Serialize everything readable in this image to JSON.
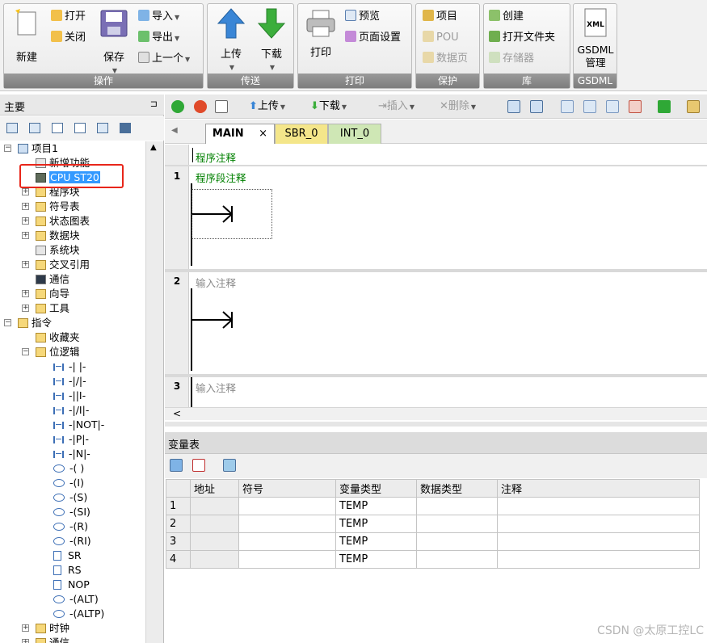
{
  "ribbon": {
    "groups": [
      {
        "title": "操作"
      },
      {
        "title": "传送"
      },
      {
        "title": "打印"
      },
      {
        "title": "保护"
      },
      {
        "title": "库"
      },
      {
        "title": "GSDML"
      }
    ],
    "new_label": "新建",
    "open_label": "打开",
    "close_label": "关闭",
    "save_label": "保存",
    "import_label": "导入",
    "export_label": "导出",
    "previous_label": "上一个",
    "upload_label": "上传",
    "download_label": "下载",
    "print_label": "打印",
    "preview_label": "预览",
    "page_setup_label": "页面设置",
    "project_label": "项目",
    "pou_label": "POU",
    "data_page_label": "数据页",
    "create_label": "创建",
    "open_folder_label": "打开文件夹",
    "memory_label": "存储器",
    "gsdml_icon_text": "XML",
    "gsdml_label_1": "GSDML",
    "gsdml_label_2": "管理"
  },
  "left_panel": {
    "title": "主要",
    "pin": "⊐",
    "tree": [
      {
        "label": "项目1",
        "level": 0,
        "expand": "−",
        "icon": "project"
      },
      {
        "label": "新增功能",
        "level": 1,
        "expand": "",
        "icon": "help"
      },
      {
        "label": "CPU ST20",
        "level": 1,
        "expand": "",
        "icon": "cpu",
        "selected": true
      },
      {
        "label": "程序块",
        "level": 1,
        "expand": "+",
        "icon": "folder"
      },
      {
        "label": "符号表",
        "level": 1,
        "expand": "+",
        "icon": "folder"
      },
      {
        "label": "状态图表",
        "level": 1,
        "expand": "+",
        "icon": "folder"
      },
      {
        "label": "数据块",
        "level": 1,
        "expand": "+",
        "icon": "folder"
      },
      {
        "label": "系统块",
        "level": 1,
        "expand": "",
        "icon": "doc"
      },
      {
        "label": "交叉引用",
        "level": 1,
        "expand": "+",
        "icon": "folder"
      },
      {
        "label": "通信",
        "level": 1,
        "expand": "",
        "icon": "monitor"
      },
      {
        "label": "向导",
        "level": 1,
        "expand": "+",
        "icon": "folder"
      },
      {
        "label": "工具",
        "level": 1,
        "expand": "+",
        "icon": "folder"
      },
      {
        "label": "指令",
        "level": 0,
        "expand": "−",
        "icon": "folder"
      },
      {
        "label": "收藏夹",
        "level": 1,
        "expand": "",
        "icon": "folder"
      },
      {
        "label": "位逻辑",
        "level": 1,
        "expand": "−",
        "icon": "folder"
      },
      {
        "label": "-| |-",
        "level": 2,
        "icon": "contact"
      },
      {
        "label": "-|/|-",
        "level": 2,
        "icon": "contact"
      },
      {
        "label": "-||I-",
        "level": 2,
        "icon": "contact"
      },
      {
        "label": "-|/I|-",
        "level": 2,
        "icon": "contact"
      },
      {
        "label": "-|NOT|-",
        "level": 2,
        "icon": "contact"
      },
      {
        "label": "-|P|-",
        "level": 2,
        "icon": "contact"
      },
      {
        "label": "-|N|-",
        "level": 2,
        "icon": "contact"
      },
      {
        "label": "-( )",
        "level": 2,
        "icon": "coil"
      },
      {
        "label": "-(I)",
        "level": 2,
        "icon": "coil"
      },
      {
        "label": "-(S)",
        "level": 2,
        "icon": "coil"
      },
      {
        "label": "-(SI)",
        "level": 2,
        "icon": "coil"
      },
      {
        "label": "-(R)",
        "level": 2,
        "icon": "coil"
      },
      {
        "label": "-(RI)",
        "level": 2,
        "icon": "coil"
      },
      {
        "label": "SR",
        "level": 2,
        "icon": "box"
      },
      {
        "label": "RS",
        "level": 2,
        "icon": "box"
      },
      {
        "label": "NOP",
        "level": 2,
        "icon": "box"
      },
      {
        "label": "-(ALT)",
        "level": 2,
        "icon": "coil"
      },
      {
        "label": "-(ALTP)",
        "level": 2,
        "icon": "coil"
      },
      {
        "label": "时钟",
        "level": 1,
        "expand": "+",
        "icon": "folder"
      },
      {
        "label": "通信",
        "level": 1,
        "expand": "+",
        "icon": "folder"
      }
    ]
  },
  "editor_toolbar": {
    "upload_label": "上传",
    "download_label": "下载",
    "insert_label": "插入",
    "delete_label": "删除"
  },
  "tabs": [
    {
      "label": "MAIN",
      "close": "×",
      "color": "#ffffff"
    },
    {
      "label": "SBR_0",
      "color": "#f4e68a"
    },
    {
      "label": "INT_0",
      "color": "#cfe7b5"
    }
  ],
  "editor": {
    "program_comment": "程序注释",
    "networks": [
      {
        "number": "1",
        "comment": "程序段注释"
      },
      {
        "number": "2",
        "comment": "输入注释"
      },
      {
        "number": "3",
        "comment": "输入注释"
      }
    ],
    "scroll_left": "<"
  },
  "variable_table": {
    "title": "变量表",
    "columns": [
      "",
      "地址",
      "符号",
      "变量类型",
      "数据类型",
      "注释"
    ],
    "rows": [
      [
        "1",
        "",
        "",
        "TEMP",
        "",
        ""
      ],
      [
        "2",
        "",
        "",
        "TEMP",
        "",
        ""
      ],
      [
        "3",
        "",
        "",
        "TEMP",
        "",
        ""
      ],
      [
        "4",
        "",
        "",
        "TEMP",
        "",
        ""
      ]
    ]
  },
  "watermark": "CSDN @太原工控LC",
  "colors": {
    "accent_red": "#e8261a",
    "selection": "#3399ff",
    "comment_green": "#008000",
    "upload_blue": "#3a86d6",
    "download_green": "#3cae3c"
  }
}
